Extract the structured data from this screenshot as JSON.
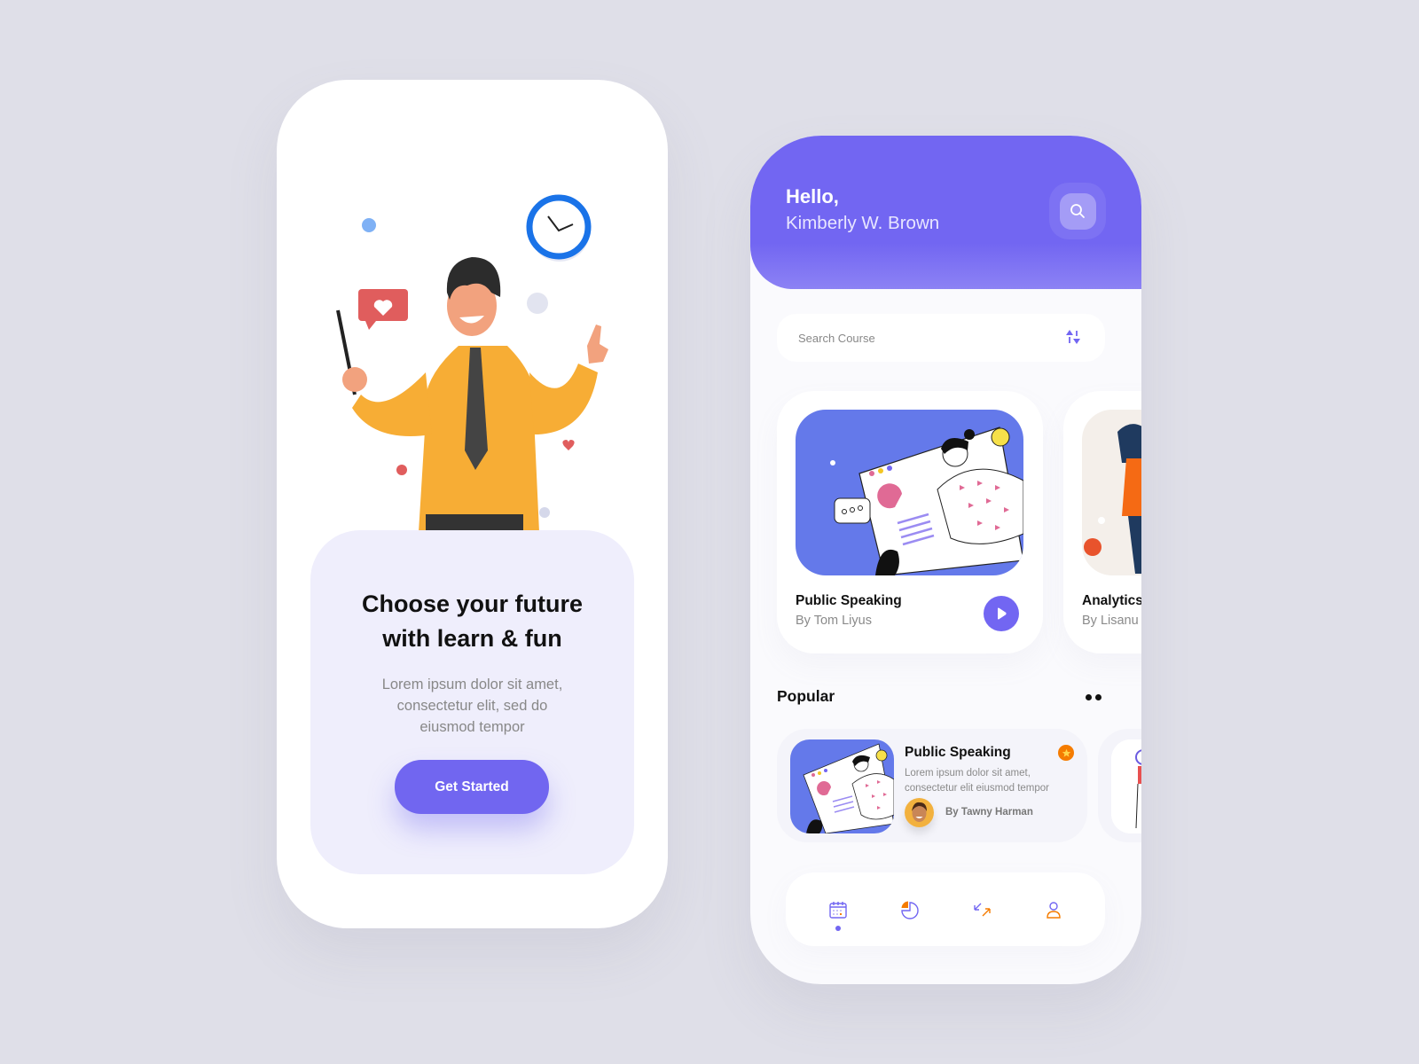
{
  "onboarding": {
    "title_line1": "Choose your future",
    "title_line2": "with learn & fun",
    "subtitle_line1": "Lorem ipsum dolor sit amet,",
    "subtitle_line2": "consectetur elit, sed do",
    "subtitle_line3": "eiusmod tempor",
    "cta_label": "Get Started"
  },
  "home": {
    "greeting": "Hello,",
    "user_name": "Kimberly W. Brown",
    "search": {
      "placeholder": "Search Course",
      "value": ""
    },
    "courses": [
      {
        "title": "Public Speaking",
        "author": "By Tom Liyus"
      },
      {
        "title": "Analytics",
        "author": "By Lisanu"
      }
    ],
    "popular": {
      "heading": "Popular",
      "items": [
        {
          "title": "Public Speaking",
          "desc_line1": "Lorem ipsum dolor sit amet,",
          "desc_line2": "consectetur elit eiusmod tempor",
          "author": "By Tawny Harman"
        }
      ]
    },
    "nav": [
      {
        "icon": "calendar-icon",
        "active": true
      },
      {
        "icon": "pie-chart-icon",
        "active": false
      },
      {
        "icon": "swap-arrows-icon",
        "active": false
      },
      {
        "icon": "user-icon",
        "active": false
      }
    ]
  },
  "colors": {
    "accent": "#7266f2",
    "orange": "#f57c00",
    "background": "#dfdfe8",
    "card_lavender": "#efeefc"
  }
}
